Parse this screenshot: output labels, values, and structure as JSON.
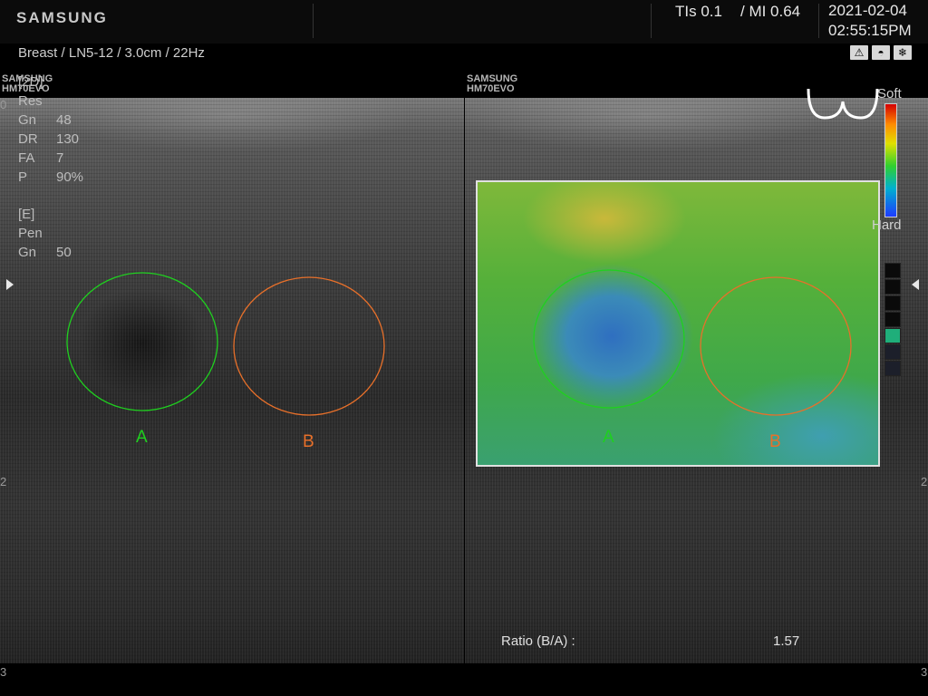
{
  "header": {
    "brand": "SAMSUNG",
    "tis": "TIs 0.1",
    "mi": "/ MI 0.64",
    "date": "2021-02-04",
    "time": "02:55:15PM",
    "preset": "Breast / LN5-12 / 3.0cm / 22Hz",
    "icons": [
      "warning-icon",
      "probe-icon",
      "freeze-icon"
    ]
  },
  "watermark": {
    "line1": "SAMSUNG",
    "line2": "HM70EVO"
  },
  "params_2d": {
    "title": "[2D]",
    "rows": [
      {
        "k": "Res",
        "v": ""
      },
      {
        "k": "Gn",
        "v": "48"
      },
      {
        "k": "DR",
        "v": "130"
      },
      {
        "k": "FA",
        "v": "7"
      },
      {
        "k": "P",
        "v": "90%"
      }
    ]
  },
  "params_e": {
    "title": "[E]",
    "rows": [
      {
        "k": "Pen",
        "v": ""
      },
      {
        "k": "Gn",
        "v": "50"
      }
    ]
  },
  "roi": {
    "a_label": "A",
    "b_label": "B",
    "a_color": "#1fd01f",
    "b_color": "#e8702a"
  },
  "scale": {
    "soft": "Soft",
    "hard": "Hard"
  },
  "depth_ticks": {
    "mid": "2",
    "bottom": "3",
    "top": "0"
  },
  "ratio": {
    "label": "Ratio (B/A) :",
    "value": "1.57"
  }
}
